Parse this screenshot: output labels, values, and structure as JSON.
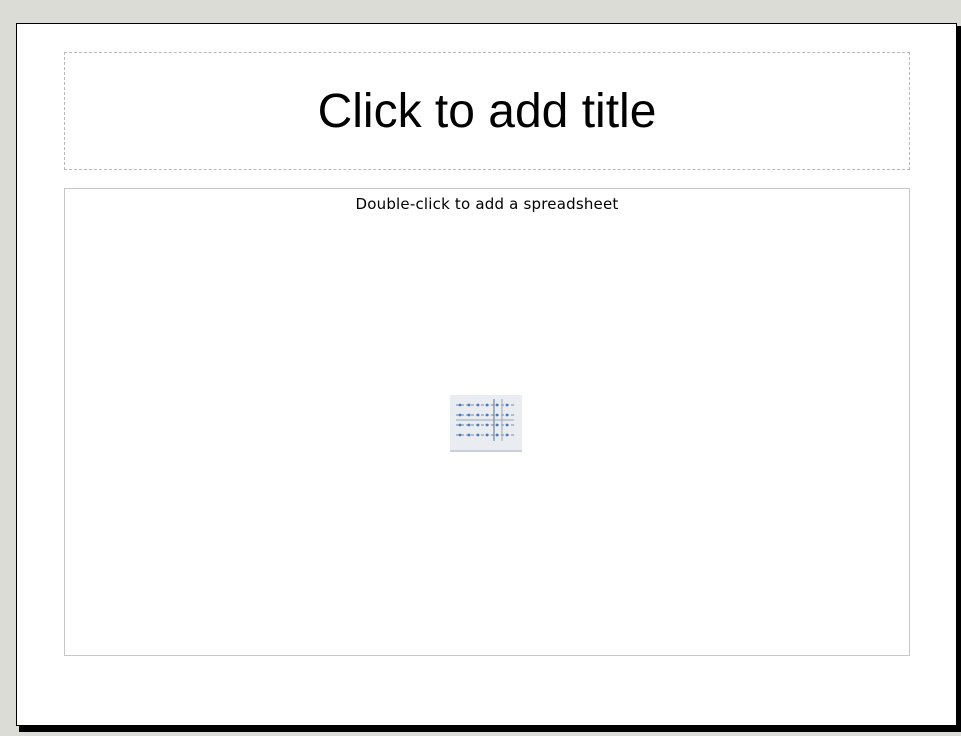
{
  "slide": {
    "title_placeholder": "Click to add title",
    "object_placeholder": "Double-click to add a spreadsheet"
  },
  "icons": {
    "object": "spreadsheet-icon"
  },
  "colors": {
    "workspace_background": "#dcdcd6",
    "slide_background": "#ffffff",
    "placeholder_border": "#b9b9b9",
    "icon_accent": "#4a7ab8"
  }
}
